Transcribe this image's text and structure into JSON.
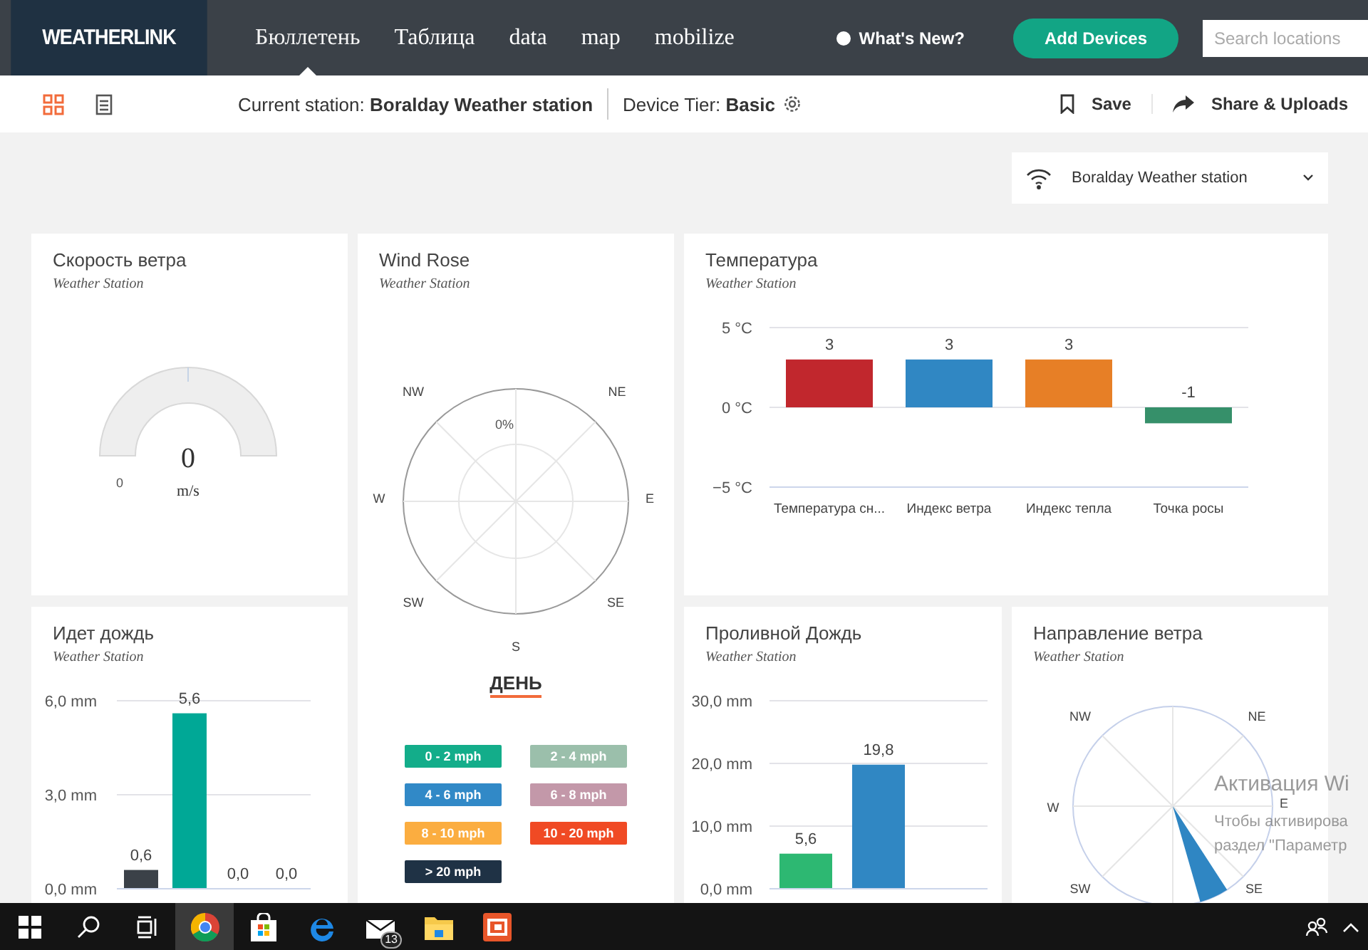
{
  "nav": {
    "logo": "WEATHERLINK",
    "tabs": [
      {
        "label": "Бюллетень",
        "selected": true
      },
      {
        "label": "Таблица",
        "selected": false
      },
      {
        "label": "data",
        "selected": false
      },
      {
        "label": "map",
        "selected": false
      },
      {
        "label": "mobilize",
        "selected": false
      }
    ],
    "whats_new": "What's New?",
    "add_button": "Add Devices",
    "search": {
      "placeholder": "Search locations"
    }
  },
  "toolbar": {
    "views": [
      {
        "kind": "grid",
        "selected": true
      },
      {
        "kind": "list",
        "selected": false
      }
    ],
    "station": "Current station: **Boralday Weather station**",
    "tier": "Device Tier: **Basic**",
    "save": "Save",
    "share": "Share & Uploads"
  },
  "station_select": {
    "value": "Boralday Weather station"
  },
  "cards": [
    {
      "kind": "gauge",
      "title": "Скорость ветра",
      "subtitle": "Weather Station",
      "value": "0",
      "unit": "m/s",
      "min_label": "0"
    },
    {
      "kind": "rose",
      "title": "Wind Rose",
      "subtitle": "Weather Station",
      "directions": [
        "NW",
        "NE",
        "W",
        "E",
        "SW",
        "SE",
        "S"
      ],
      "ring_label": "0%",
      "period": "ДЕНЬ",
      "legend": [
        {
          "label": "0 - 2 mph",
          "color": "#13ad8a"
        },
        {
          "label": "2 - 4 mph",
          "color": "#9bbfab"
        },
        {
          "label": "4 - 6 mph",
          "color": "#3189c7"
        },
        {
          "label": "6 - 8 mph",
          "color": "#c398a9"
        },
        {
          "label": "8 - 10 mph",
          "color": "#fbad40"
        },
        {
          "label": "10 - 20 mph",
          "color": "#f04a24"
        },
        {
          "label": "> 20 mph",
          "color": "#1f3245"
        }
      ]
    },
    {
      "kind": "chart",
      "title": "Температура",
      "subtitle": "Weather Station",
      "chart_data": {
        "type": "bar",
        "categories": [
          "Температура сн...",
          "Индекс ветра",
          "Индекс тепла",
          "Точка росы"
        ],
        "values": [
          3,
          3,
          3,
          -1
        ],
        "colors": [
          "#c1272d",
          "#3087c3",
          "#e77f26",
          "#36906a"
        ],
        "ylim": [
          -5,
          5
        ],
        "yticks": [
          {
            "value": 5,
            "label": "5 °C"
          },
          {
            "value": 0,
            "label": "0 °C"
          },
          {
            "value": -5,
            "label": "−5 °C"
          }
        ],
        "value_labels": [
          "3",
          "3",
          "3",
          "-1"
        ]
      }
    },
    {
      "kind": "chart",
      "title": "Идет дождь",
      "subtitle": "Weather Station",
      "chart_data": {
        "type": "bar",
        "values": [
          0.6,
          5.6,
          0,
          0
        ],
        "colors": [
          "#3b4148",
          "#00a896",
          null,
          null
        ],
        "ylim": [
          0,
          6
        ],
        "yticks": [
          {
            "value": 0,
            "label": "0,0 mm"
          },
          {
            "value": 3,
            "label": "3,0 mm"
          },
          {
            "value": 6,
            "label": "6,0 mm"
          }
        ],
        "value_labels": [
          "0,6",
          "5,6",
          "0,0",
          "0,0"
        ]
      }
    },
    {
      "kind": "chart",
      "title": "Проливной Дождь",
      "subtitle": "Weather Station",
      "chart_data": {
        "type": "bar",
        "values": [
          5.6,
          19.8
        ],
        "colors": [
          "#2db872",
          "#3087c3"
        ],
        "ylim": [
          0,
          30
        ],
        "yticks": [
          {
            "value": 0,
            "label": "0,0 mm"
          },
          {
            "value": 10,
            "label": "10,0 mm"
          },
          {
            "value": 20,
            "label": "20,0 mm"
          },
          {
            "value": 30,
            "label": "30,0 mm"
          }
        ],
        "value_labels": [
          "5,6",
          "19,8"
        ]
      }
    },
    {
      "kind": "compass",
      "title": "Направление ветра",
      "subtitle": "Weather Station",
      "directions": [
        "NW",
        "NE",
        "W",
        "E",
        "SW",
        "SE"
      ]
    }
  ],
  "activation_notice": {
    "title": "Активация Wi",
    "lines": [
      "Чтобы активирова",
      "раздел \"Параметр"
    ]
  },
  "taskbar": {
    "apps": [
      {
        "kind": "windows",
        "selected": false
      },
      {
        "kind": "search",
        "selected": false
      },
      {
        "kind": "taskview",
        "selected": false
      },
      {
        "kind": "browser",
        "selected": true
      },
      {
        "kind": "store",
        "selected": false
      },
      {
        "kind": "edge",
        "selected": false
      },
      {
        "kind": "mail",
        "selected": false,
        "badge": "13"
      },
      {
        "kind": "folder",
        "selected": false
      },
      {
        "kind": "office",
        "selected": false
      }
    ]
  }
}
